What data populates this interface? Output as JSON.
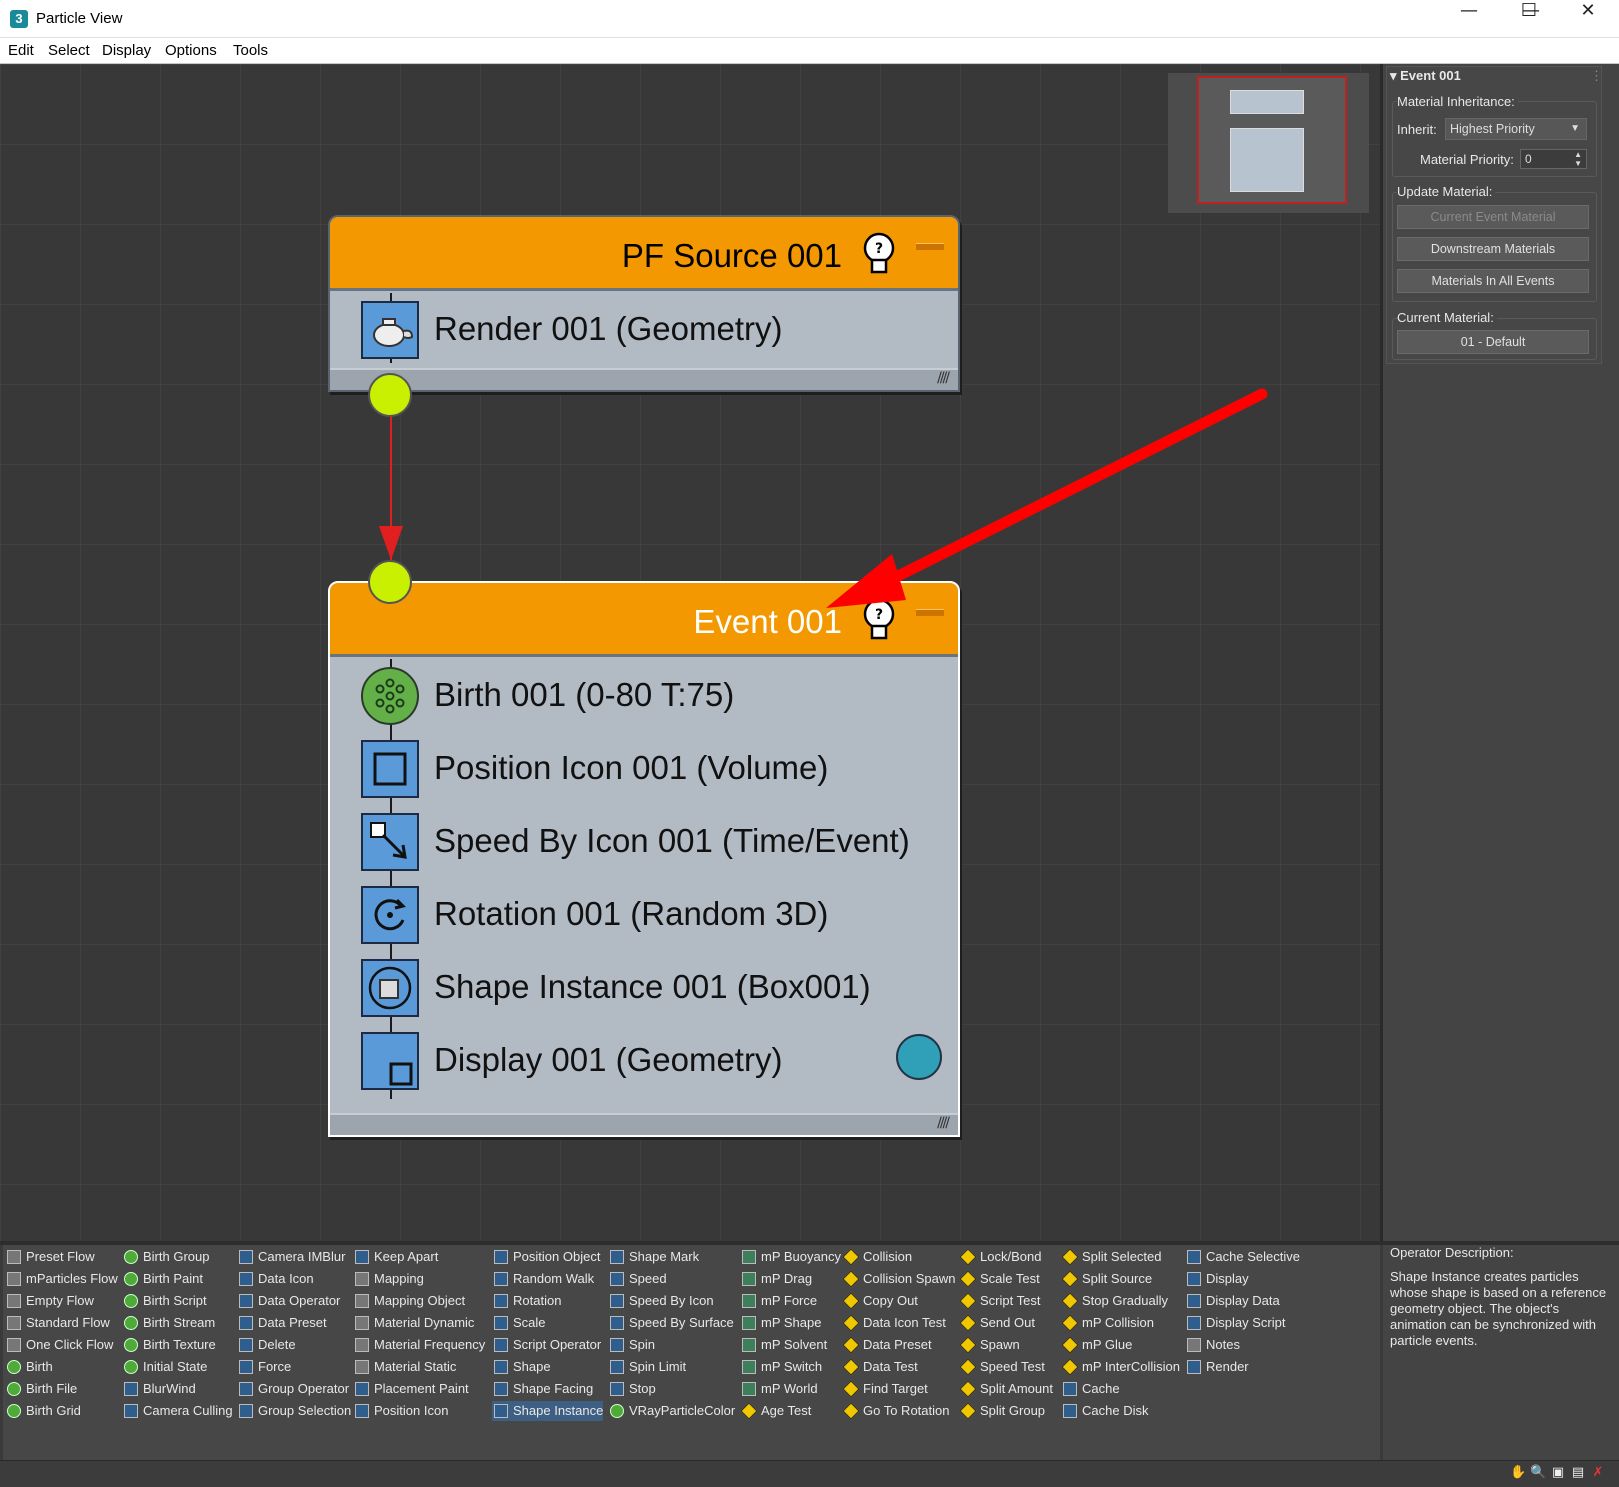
{
  "window": {
    "title": "Particle View",
    "app_icon": "3"
  },
  "menu": [
    "Edit",
    "Select",
    "Display",
    "Options",
    "Tools"
  ],
  "nodes": {
    "source": {
      "title": "PF Source 001",
      "operators": [
        {
          "label": "Render 001 (Geometry)",
          "icon": "teapot-icon"
        }
      ]
    },
    "event": {
      "title": "Event 001",
      "operators": [
        {
          "label": "Birth 001 (0-80 T:75)",
          "icon": "birth-icon"
        },
        {
          "label": "Position Icon 001 (Volume)",
          "icon": "position-icon"
        },
        {
          "label": "Speed By Icon 001 (Time/Event)",
          "icon": "speed-icon"
        },
        {
          "label": "Rotation 001 (Random 3D)",
          "icon": "rotation-icon"
        },
        {
          "label": "Shape Instance 001 (Box001)",
          "icon": "shape-instance-icon"
        },
        {
          "label": "Display 001 (Geometry)",
          "icon": "display-icon"
        }
      ]
    }
  },
  "params": {
    "rollout_title": "Event 001",
    "material_inheritance": "Material Inheritance:",
    "inherit_label": "Inherit:",
    "inherit_value": "Highest Priority",
    "priority_label": "Material Priority:",
    "priority_value": "0",
    "update_material": "Update Material:",
    "btn_current_event": "Current Event Material",
    "btn_downstream": "Downstream Materials",
    "btn_all_events": "Materials In All Events",
    "current_material": "Current Material:",
    "current_material_value": "01 - Default"
  },
  "depot": {
    "columns": [
      [
        {
          "label": "Preset Flow",
          "icon": "gray"
        },
        {
          "label": "mParticles Flow",
          "icon": "gray"
        },
        {
          "label": "Empty Flow",
          "icon": "gray"
        },
        {
          "label": "Standard Flow",
          "icon": "gray"
        },
        {
          "label": "One Click Flow",
          "icon": "gray"
        },
        {
          "label": "Birth",
          "icon": "green"
        },
        {
          "label": "Birth File",
          "icon": "green"
        },
        {
          "label": "Birth Grid",
          "icon": "green"
        }
      ],
      [
        {
          "label": "Birth Group",
          "icon": "green"
        },
        {
          "label": "Birth Paint",
          "icon": "green"
        },
        {
          "label": "Birth Script",
          "icon": "green"
        },
        {
          "label": "Birth Stream",
          "icon": "green"
        },
        {
          "label": "Birth Texture",
          "icon": "green"
        },
        {
          "label": "Initial State",
          "icon": "green"
        },
        {
          "label": "BlurWind",
          "icon": "blue"
        },
        {
          "label": "Camera Culling",
          "icon": "blue"
        }
      ],
      [
        {
          "label": "Camera IMBlur",
          "icon": "blue"
        },
        {
          "label": "Data Icon",
          "icon": "blue"
        },
        {
          "label": "Data Operator",
          "icon": "blue"
        },
        {
          "label": "Data Preset",
          "icon": "blue"
        },
        {
          "label": "Delete",
          "icon": "blue"
        },
        {
          "label": "Force",
          "icon": "blue"
        },
        {
          "label": "Group Operator",
          "icon": "blue"
        },
        {
          "label": "Group Selection",
          "icon": "blue"
        }
      ],
      [
        {
          "label": "Keep Apart",
          "icon": "blue"
        },
        {
          "label": "Mapping",
          "icon": "gray"
        },
        {
          "label": "Mapping Object",
          "icon": "gray"
        },
        {
          "label": "Material Dynamic",
          "icon": "gray"
        },
        {
          "label": "Material Frequency",
          "icon": "gray"
        },
        {
          "label": "Material Static",
          "icon": "gray"
        },
        {
          "label": "Placement Paint",
          "icon": "blue"
        },
        {
          "label": "Position Icon",
          "icon": "blue"
        }
      ],
      [
        {
          "label": "Position Object",
          "icon": "blue"
        },
        {
          "label": "Random Walk",
          "icon": "blue"
        },
        {
          "label": "Rotation",
          "icon": "blue"
        },
        {
          "label": "Scale",
          "icon": "blue"
        },
        {
          "label": "Script Operator",
          "icon": "blue"
        },
        {
          "label": "Shape",
          "icon": "blue"
        },
        {
          "label": "Shape Facing",
          "icon": "blue"
        },
        {
          "label": "Shape Instance",
          "icon": "blue",
          "selected": true
        }
      ],
      [
        {
          "label": "Shape Mark",
          "icon": "blue"
        },
        {
          "label": "Speed",
          "icon": "blue"
        },
        {
          "label": "Speed By Icon",
          "icon": "blue"
        },
        {
          "label": "Speed By Surface",
          "icon": "blue"
        },
        {
          "label": "Spin",
          "icon": "blue"
        },
        {
          "label": "Spin Limit",
          "icon": "blue"
        },
        {
          "label": "Stop",
          "icon": "blue"
        },
        {
          "label": "VRayParticleColor",
          "icon": "green"
        }
      ],
      [
        {
          "label": "mP Buoyancy",
          "icon": "teal"
        },
        {
          "label": "mP Drag",
          "icon": "teal"
        },
        {
          "label": "mP Force",
          "icon": "teal"
        },
        {
          "label": "mP Shape",
          "icon": "teal"
        },
        {
          "label": "mP Solvent",
          "icon": "teal"
        },
        {
          "label": "mP Switch",
          "icon": "teal"
        },
        {
          "label": "mP World",
          "icon": "teal"
        },
        {
          "label": "Age Test",
          "icon": "yellow"
        }
      ],
      [
        {
          "label": "Collision",
          "icon": "yellow"
        },
        {
          "label": "Collision Spawn",
          "icon": "yellow"
        },
        {
          "label": "Copy Out",
          "icon": "yellow"
        },
        {
          "label": "Data Icon Test",
          "icon": "yellow"
        },
        {
          "label": "Data Preset",
          "icon": "yellow"
        },
        {
          "label": "Data Test",
          "icon": "yellow"
        },
        {
          "label": "Find Target",
          "icon": "yellow"
        },
        {
          "label": "Go To Rotation",
          "icon": "yellow"
        }
      ],
      [
        {
          "label": "Lock/Bond",
          "icon": "yellow"
        },
        {
          "label": "Scale Test",
          "icon": "yellow"
        },
        {
          "label": "Script Test",
          "icon": "yellow"
        },
        {
          "label": "Send Out",
          "icon": "yellow"
        },
        {
          "label": "Spawn",
          "icon": "yellow"
        },
        {
          "label": "Speed Test",
          "icon": "yellow"
        },
        {
          "label": "Split Amount",
          "icon": "yellow"
        },
        {
          "label": "Split Group",
          "icon": "yellow"
        }
      ],
      [
        {
          "label": "Split Selected",
          "icon": "yellow"
        },
        {
          "label": "Split Source",
          "icon": "yellow"
        },
        {
          "label": "Stop Gradually",
          "icon": "yellow"
        },
        {
          "label": "mP Collision",
          "icon": "yellow"
        },
        {
          "label": "mP Glue",
          "icon": "yellow"
        },
        {
          "label": "mP InterCollision",
          "icon": "yellow"
        },
        {
          "label": "Cache",
          "icon": "blue"
        },
        {
          "label": "Cache Disk",
          "icon": "blue"
        }
      ],
      [
        {
          "label": "Cache Selective",
          "icon": "blue"
        },
        {
          "label": "Display",
          "icon": "blue"
        },
        {
          "label": "Display Data",
          "icon": "blue"
        },
        {
          "label": "Display Script",
          "icon": "blue"
        },
        {
          "label": "Notes",
          "icon": "gray"
        },
        {
          "label": "Render",
          "icon": "blue"
        }
      ]
    ]
  },
  "description": {
    "title": "Operator Description:",
    "text": "Shape Instance creates particles whose shape is based on a reference geometry object. The object's animation can be synchronized with particle events."
  },
  "colors": {
    "header": "#f39800",
    "port": "#c8f000",
    "wire": "#e02020",
    "arrow": "#ff0000",
    "display_dot": "#2fa0b8"
  }
}
